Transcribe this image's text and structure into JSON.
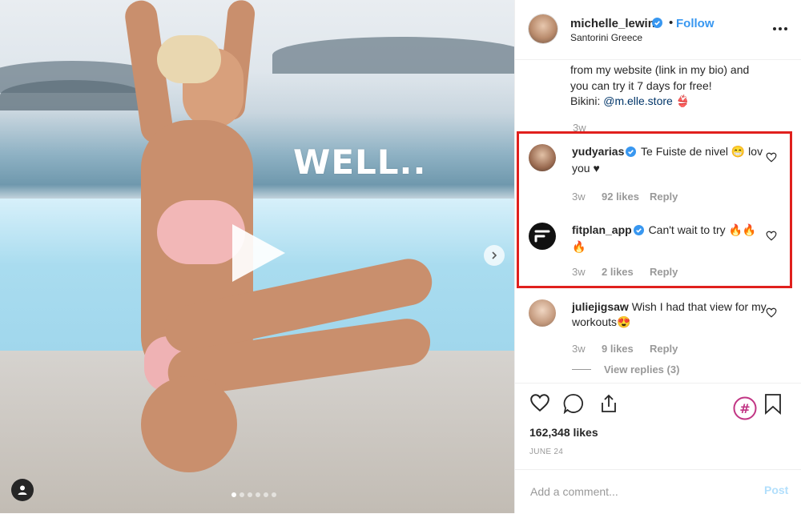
{
  "media": {
    "overlay_text": "WELL..",
    "play_icon": "play-icon",
    "next_icon": "chevron-right-icon",
    "user_tag_icon": "user-icon",
    "carousel_total": 6,
    "carousel_active_index": 0
  },
  "header": {
    "username": "michelle_lewin",
    "verified_icon": "verified-badge-icon",
    "separator": "•",
    "follow_label": "Follow",
    "location": "Santorini Greece",
    "more_icon": "more-options-icon"
  },
  "caption": {
    "line1": "from my website (link in my bio) and",
    "line2": "you can try it 7 days for free!",
    "line3_prefix": "Bikini: ",
    "line3_mention": "@m.elle.store",
    "line3_emoji": "👙",
    "time": "3w"
  },
  "comments": [
    {
      "username": "yudyarias",
      "verified": true,
      "text": "Te Fuiste de nivel 😁 lov you ♥",
      "time": "3w",
      "likes": "92 likes",
      "reply": "Reply"
    },
    {
      "username": "fitplan_app",
      "verified": true,
      "text": "Can't wait to try 🔥🔥🔥",
      "time": "3w",
      "likes": "2 likes",
      "reply": "Reply"
    },
    {
      "username": "juliejigsaw",
      "verified": false,
      "text": "Wish I had that view for my workouts😍",
      "time": "3w",
      "likes": "9 likes",
      "reply": "Reply"
    }
  ],
  "view_replies": "View replies (3)",
  "actions": {
    "like_icon": "heart-icon",
    "comment_icon": "comment-icon",
    "share_icon": "share-icon",
    "hashtag_icon": "hashtag-icon",
    "save_icon": "bookmark-icon"
  },
  "likes": "162,348 likes",
  "date": "JUNE 24",
  "comment_input": {
    "placeholder": "Add a comment...",
    "value": ""
  },
  "post_label": "Post",
  "colors": {
    "accent": "#3897f0",
    "highlight": "#e0201d",
    "post_disabled": "#b2dffc"
  }
}
